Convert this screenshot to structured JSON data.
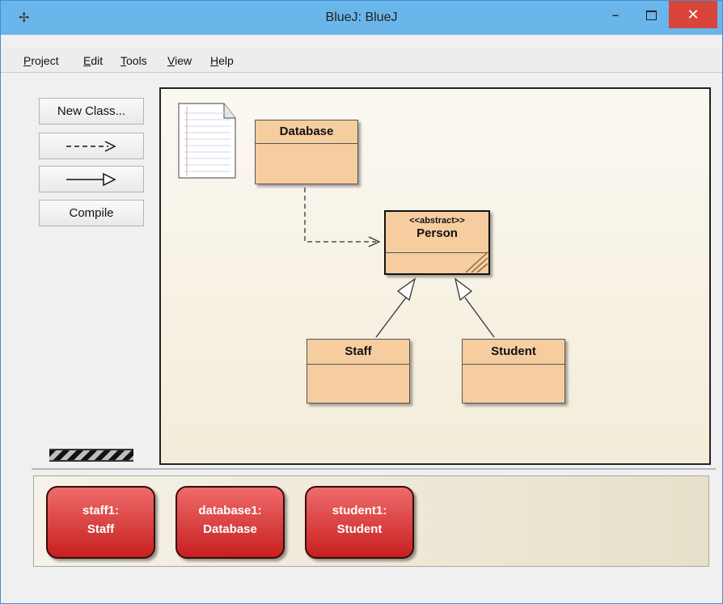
{
  "window": {
    "title": "BlueJ:  BlueJ",
    "app_icon": "bluej-bird-icon",
    "minimize_glyph": "–",
    "close_glyph": "✕"
  },
  "menu": {
    "items": [
      {
        "label": "Project",
        "mnemonic_index": 0
      },
      {
        "label": "Edit",
        "mnemonic_index": 0
      },
      {
        "label": "Tools",
        "mnemonic_index": 0
      },
      {
        "label": "View",
        "mnemonic_index": 0
      },
      {
        "label": "Help",
        "mnemonic_index": 0
      }
    ]
  },
  "toolbar": {
    "new_class_label": "New Class...",
    "uses_arrow_label": "- - ->",
    "inherits_arrow_label": "—▷",
    "compile_label": "Compile"
  },
  "diagram": {
    "readme_icon": "readme-document-icon",
    "classes": {
      "database": {
        "name": "Database"
      },
      "person": {
        "stereotype": "<<abstract>>",
        "name": "Person"
      },
      "staff": {
        "name": "Staff"
      },
      "student": {
        "name": "Student"
      }
    },
    "relations": [
      {
        "from": "Database",
        "to": "Person",
        "kind": "uses"
      },
      {
        "from": "Staff",
        "to": "Person",
        "kind": "inherits"
      },
      {
        "from": "Student",
        "to": "Person",
        "kind": "inherits"
      }
    ]
  },
  "object_bench": {
    "objects": [
      {
        "instance": "staff1:",
        "type": "Staff"
      },
      {
        "instance": "database1:",
        "type": "Database"
      },
      {
        "instance": "student1:",
        "type": "Student"
      }
    ]
  },
  "colors": {
    "titlebar": "#6ab5ea",
    "close_button": "#d9443b",
    "class_fill": "#f6cd9f",
    "object_fill": "#d83232"
  }
}
